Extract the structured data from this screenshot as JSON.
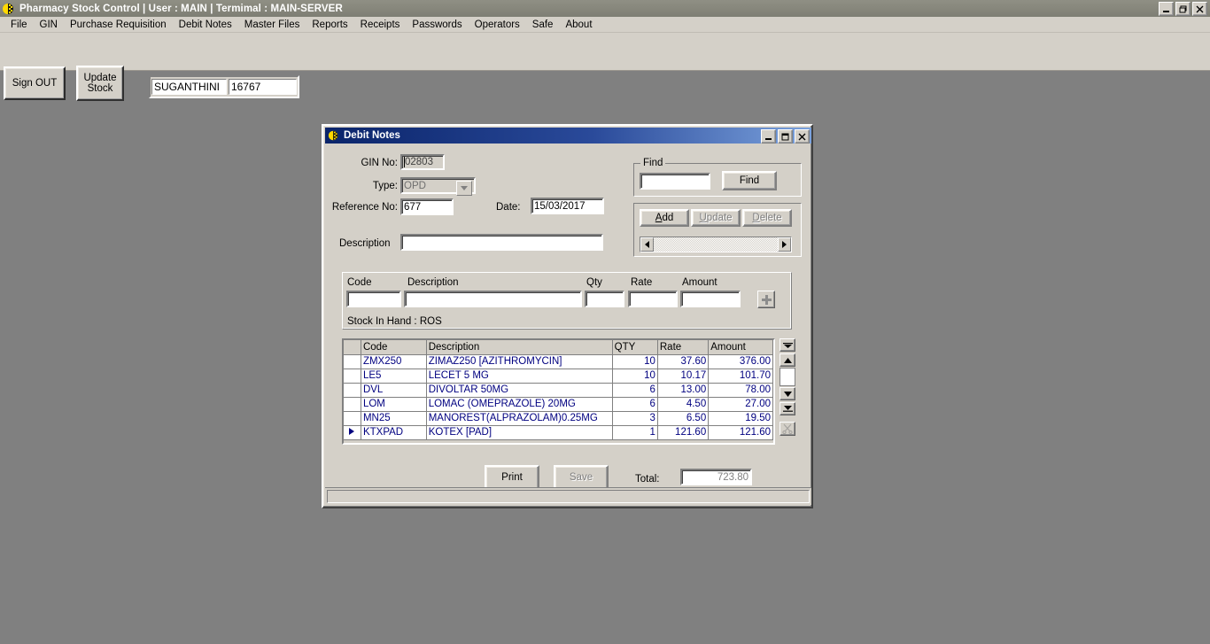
{
  "app": {
    "title": "Pharmacy Stock Control | User : MAIN | Termimal : MAIN-SERVER",
    "icon": "pharmacy-icon",
    "window_buttons": {
      "minimize": "minimize-icon",
      "restore": "restore-icon",
      "close": "close-icon"
    },
    "menu": [
      {
        "label": "File"
      },
      {
        "label": "GIN"
      },
      {
        "label": "Purchase Requisition"
      },
      {
        "label": "Debit Notes"
      },
      {
        "label": "Master Files"
      },
      {
        "label": "Reports"
      },
      {
        "label": "Receipts"
      },
      {
        "label": "Passwords"
      },
      {
        "label": "Operators"
      },
      {
        "label": "Safe"
      },
      {
        "label": "About"
      }
    ],
    "toolbar": {
      "sign_out_label": "Sign OUT",
      "update_stock_label_1": "Update",
      "update_stock_label_2": "Stock",
      "user_name": "SUGANTHINI",
      "user_code": "16767"
    }
  },
  "dialog": {
    "title": "Debit Notes",
    "icon": "pharmacy-icon",
    "window_buttons": {
      "minimize": "minimize-icon",
      "restore": "restore-icon",
      "close": "close-icon"
    },
    "form": {
      "gin_no_label": "GIN No:",
      "gin_no_value": "02803",
      "type_label": "Type:",
      "type_value": "OPD",
      "reference_no_label": "Reference No:",
      "reference_no_value": "677",
      "date_label": "Date:",
      "date_value": "15/03/2017",
      "description_label": "Description",
      "description_value": "",
      "description_placeholder": ""
    },
    "find": {
      "legend": "Find",
      "input_value": "",
      "button_label": "Find"
    },
    "record_actions": {
      "add_label": "Add",
      "add_accel": "A",
      "update_label": "Update",
      "update_accel": "U",
      "update_disabled": true,
      "delete_label": "Delete",
      "delete_accel": "D",
      "delete_disabled": true,
      "scroll_left_icon": "arrow-left-icon",
      "scroll_right_icon": "arrow-right-icon"
    },
    "entry": {
      "headers": [
        "Code",
        "Description",
        "Qty",
        "Rate",
        "Amount"
      ],
      "code_value": "",
      "description_value": "",
      "qty_value": "",
      "rate_value": "",
      "amount_value": "",
      "add_row_icon": "plus-icon",
      "stock_in_hand_label": "Stock In Hand :  ROS"
    },
    "grid": {
      "columns": [
        "Code",
        "Description",
        "QTY",
        "Rate",
        "Amount"
      ],
      "rows": [
        {
          "marker": "",
          "code": "ZMX250",
          "description": "ZIMAZ250 [AZITHROMYCIN]",
          "qty": "10",
          "rate": "37.60",
          "amount": "376.00"
        },
        {
          "marker": "",
          "code": "LE5",
          "description": "LECET 5 MG",
          "qty": "10",
          "rate": "10.17",
          "amount": "101.70"
        },
        {
          "marker": "",
          "code": "DVL",
          "description": "DIVOLTAR 50MG",
          "qty": "6",
          "rate": "13.00",
          "amount": "78.00"
        },
        {
          "marker": "",
          "code": "LOM",
          "description": "LOMAC (OMEPRAZOLE) 20MG",
          "qty": "6",
          "rate": "4.50",
          "amount": "27.00"
        },
        {
          "marker": "",
          "code": "MN25",
          "description": "MANOREST(ALPRAZOLAM)0.25MG",
          "qty": "3",
          "rate": "6.50",
          "amount": "19.50"
        },
        {
          "marker": "current",
          "code": "KTXPAD",
          "description": "KOTEX [PAD]",
          "qty": "1",
          "rate": "121.60",
          "amount": "121.60"
        }
      ],
      "nav": {
        "first_icon": "first-record-icon",
        "prev_icon": "prev-record-icon",
        "next_icon": "next-record-icon",
        "last_icon": "last-record-icon",
        "cut_icon": "cut-icon",
        "cut_disabled": true
      }
    },
    "footer": {
      "print_label": "Print",
      "save_label": "Save",
      "save_disabled": true,
      "total_label": "Total:",
      "total_value": "723.80"
    },
    "status_text": ""
  },
  "colors": {
    "desktop": "#808080",
    "face": "#d4d0c8",
    "title_active": "#0a246a",
    "grid_text": "#000080",
    "disabled_text": "#808080"
  }
}
